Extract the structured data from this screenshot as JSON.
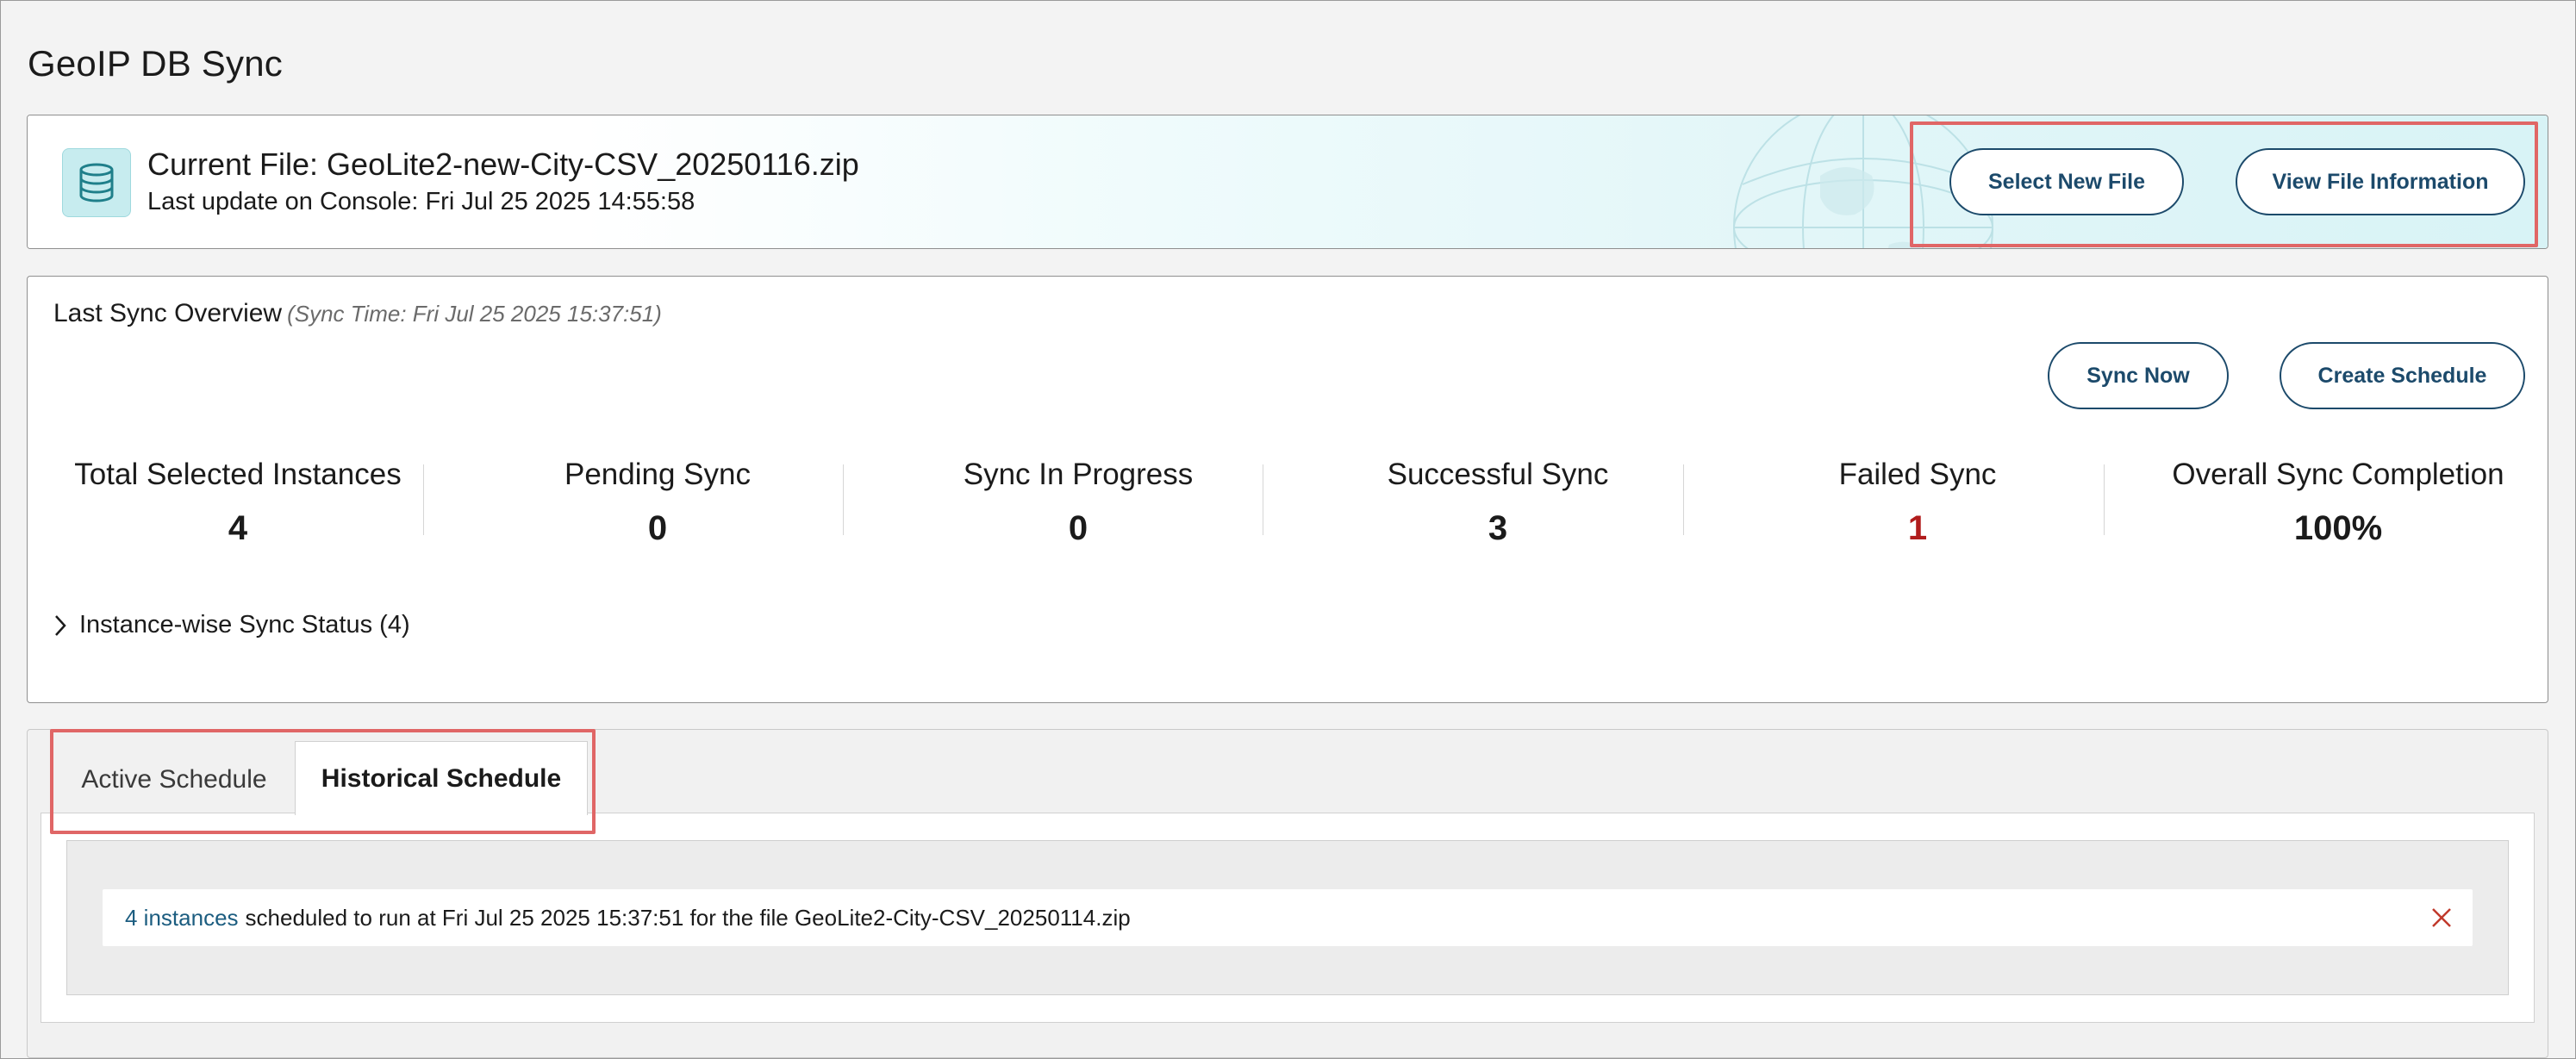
{
  "page": {
    "title": "GeoIP DB Sync"
  },
  "current_file": {
    "title": "Current File: GeoLite2-new-City-CSV_20250116.zip",
    "last_update": "Last update on Console: Fri Jul 25 2025 14:55:58",
    "icon": "database-icon",
    "buttons": {
      "select_new_file": "Select New File",
      "view_file_information": "View File Information"
    },
    "accent_color": "#1c4a6b"
  },
  "sync_overview": {
    "title": "Last Sync Overview",
    "sync_time": "(Sync Time: Fri Jul 25 2025 15:37:51)",
    "buttons": {
      "sync_now": "Sync Now",
      "create_schedule": "Create Schedule"
    },
    "stats": [
      {
        "label": "Total Selected Instances",
        "value": "4"
      },
      {
        "label": "Pending Sync",
        "value": "0"
      },
      {
        "label": "Sync In Progress",
        "value": "0"
      },
      {
        "label": "Successful Sync",
        "value": "3"
      },
      {
        "label": "Failed Sync",
        "value": "1"
      },
      {
        "label": "Overall Sync Completion",
        "value": "100%"
      }
    ],
    "failed_color": "#b11c1c",
    "expander_label": "Instance-wise Sync Status (4)"
  },
  "schedule": {
    "tabs": [
      {
        "label": "Active Schedule",
        "active": false
      },
      {
        "label": "Historical Schedule",
        "active": true
      }
    ],
    "entries": [
      {
        "link_text": "4 instances",
        "text": "scheduled to run at Fri Jul 25 2025 15:37:51 for the file GeoLite2-City-CSV_20250114.zip"
      }
    ],
    "close_icon": "close-icon"
  },
  "highlight_color": "#e06666"
}
